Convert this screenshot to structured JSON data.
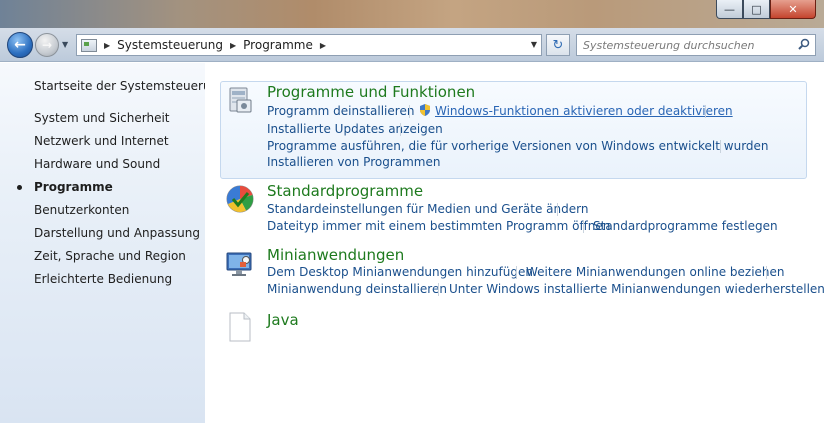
{
  "window": {
    "minimize_glyph": "—",
    "maximize_glyph": "□",
    "close_glyph": "✕"
  },
  "nav": {
    "back_glyph": "←",
    "forward_glyph": "→",
    "history_glyph": "▼",
    "breadcrumb": [
      "Systemsteuerung",
      "Programme"
    ],
    "separator_glyph": "▶",
    "refresh_glyph": "↻",
    "search_placeholder": "Systemsteuerung durchsuchen"
  },
  "sidebar": {
    "home": "Startseite der Systemsteuerung",
    "items": [
      {
        "label": "System und Sicherheit"
      },
      {
        "label": "Netzwerk und Internet"
      },
      {
        "label": "Hardware und Sound"
      },
      {
        "label": "Programme",
        "active": true
      },
      {
        "label": "Benutzerkonten"
      },
      {
        "label": "Darstellung und Anpassung"
      },
      {
        "label": "Zeit, Sprache und Region"
      },
      {
        "label": "Erleichterte Bedienung"
      }
    ]
  },
  "sections": [
    {
      "title": "Programme und Funktionen",
      "icon": "programs-features-icon",
      "links": [
        "Programm deinstallieren",
        "Windows-Funktionen aktivieren oder deaktivieren",
        "Installierte Updates anzeigen",
        "Programme ausführen, die für vorherige Versionen von Windows entwickelt wurden",
        "Installieren von Programmen"
      ]
    },
    {
      "title": "Standardprogramme",
      "icon": "default-programs-icon",
      "links": [
        "Standardeinstellungen für Medien und Geräte ändern",
        "Dateityp immer mit einem bestimmten Programm öffnen",
        "Standardprogramme festlegen"
      ]
    },
    {
      "title": "Minianwendungen",
      "icon": "gadgets-icon",
      "links": [
        "Dem Desktop Minianwendungen hinzufügen",
        "Weitere Minianwendungen online beziehen",
        "Minianwendung deinstallieren",
        "Unter Windows installierte Minianwendungen wiederherstellen"
      ]
    },
    {
      "title": "Java",
      "icon": "java-file-icon",
      "links": []
    }
  ],
  "colors": {
    "section_title": "#1e7a1e",
    "link": "#1a4f8c"
  }
}
